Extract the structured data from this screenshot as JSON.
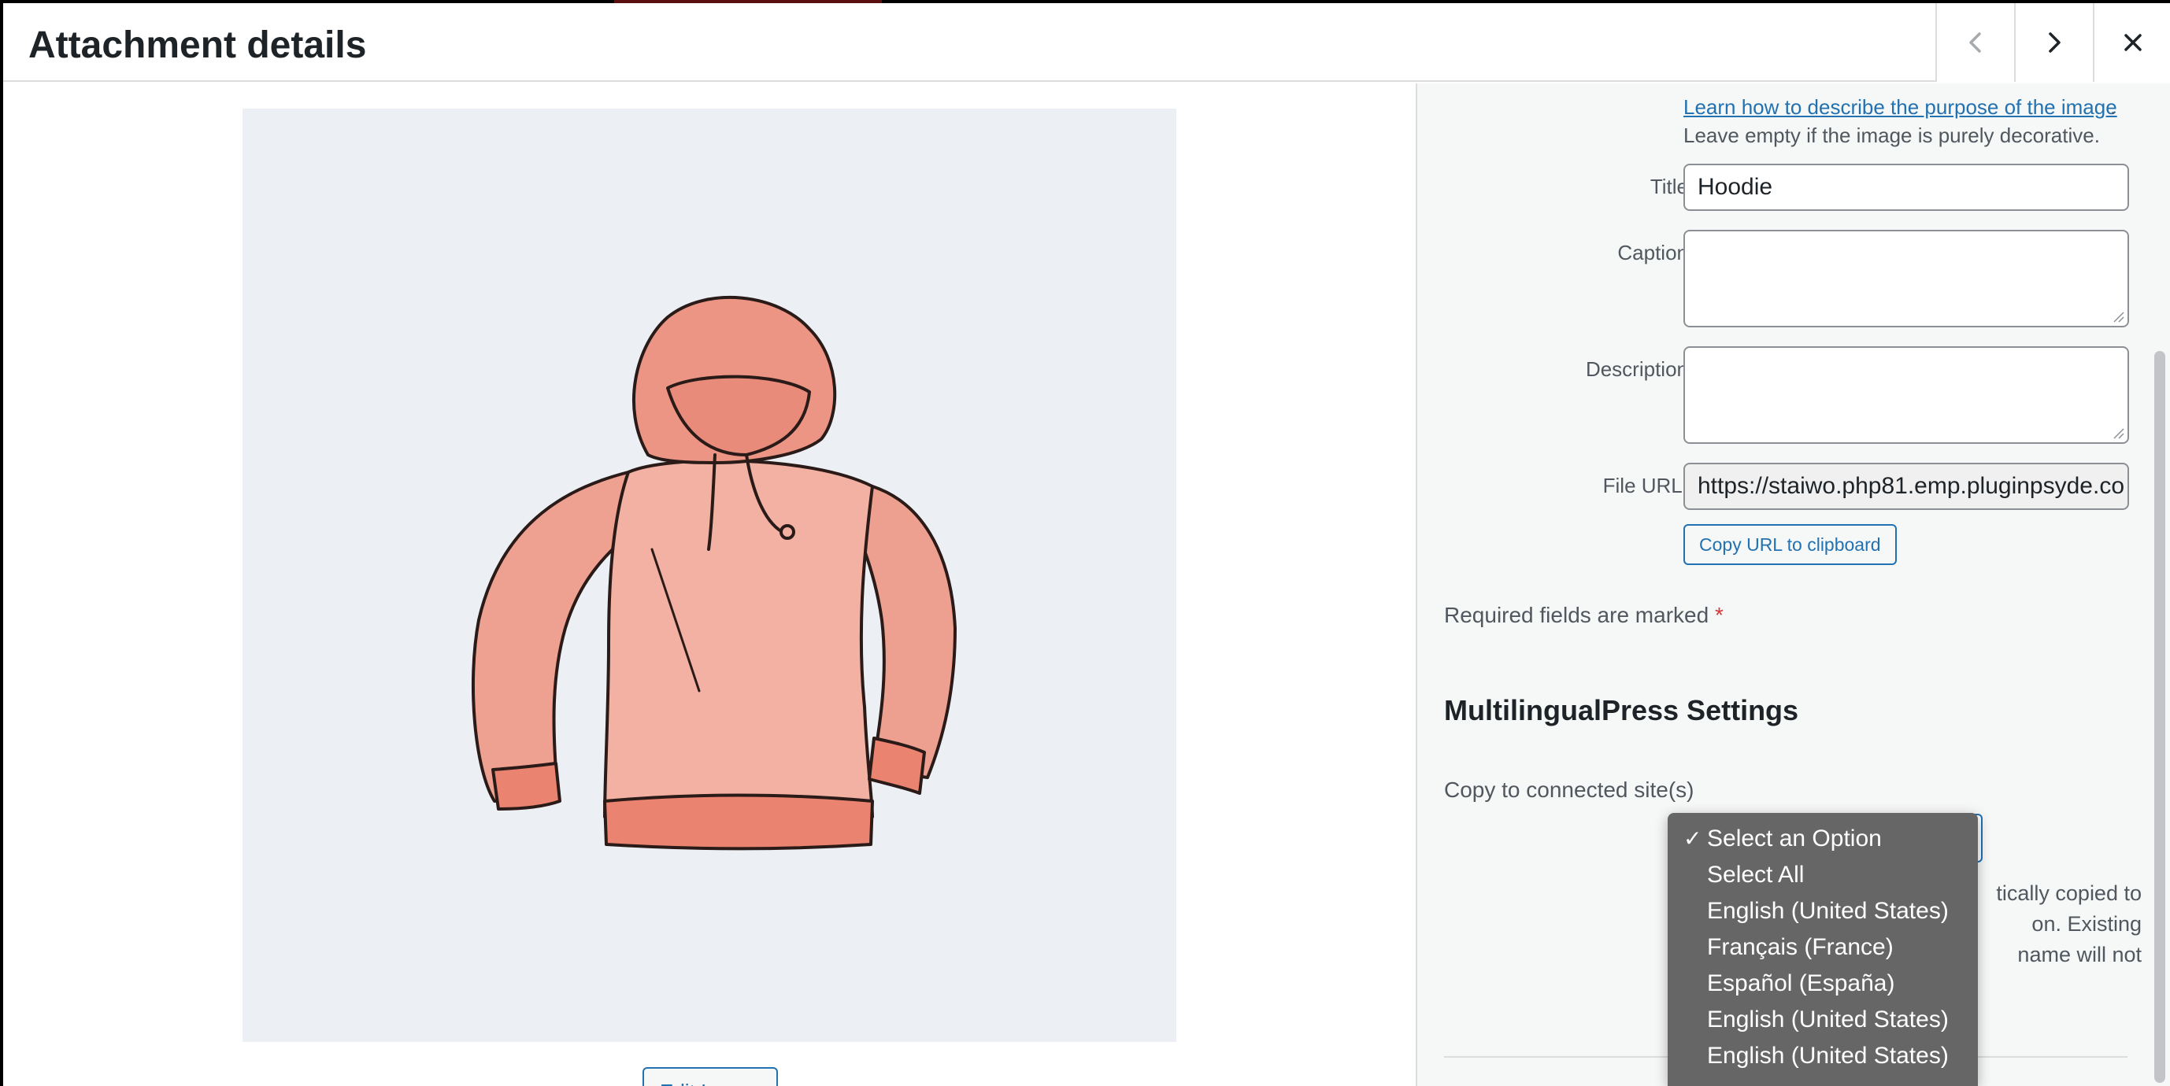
{
  "header": {
    "title": "Attachment details",
    "prev_icon": "chevron-left-icon",
    "next_icon": "chevron-right-icon",
    "close_icon": "close-icon"
  },
  "preview": {
    "image_subject": "hoodie-illustration",
    "edit_button_label": "Edit Image"
  },
  "details": {
    "alt_help_link": "Learn how to describe the purpose of the image",
    "alt_help_punct": ".",
    "alt_help_text": "Leave empty if the image is purely decorative.",
    "title_label": "Title",
    "title_value": "Hoodie",
    "caption_label": "Caption",
    "caption_value": "",
    "description_label": "Description",
    "description_value": "",
    "file_url_label": "File URL:",
    "file_url_value": "https://staiwo.php81.emp.pluginpsyde.co",
    "copy_url_button": "Copy URL to clipboard",
    "required_text": "Required fields are marked",
    "required_star": "*"
  },
  "multilingualpress": {
    "heading": "MultilingualPress Settings",
    "copy_label": "Copy to connected site(s)",
    "notice_lines": [
      "tically copied to",
      "on. Existing",
      "name will not"
    ]
  },
  "dropdown": {
    "check": "✓",
    "options": [
      "Select an Option",
      "Select All",
      "English (United States)",
      "Français (France)",
      "Español (España)",
      "English (United States)",
      "English (United States)"
    ]
  },
  "colors": {
    "link": "#2271b1",
    "dropdown_bg": "#666666",
    "required_star": "#d63638",
    "hoodie_fill": "#f0a595"
  }
}
